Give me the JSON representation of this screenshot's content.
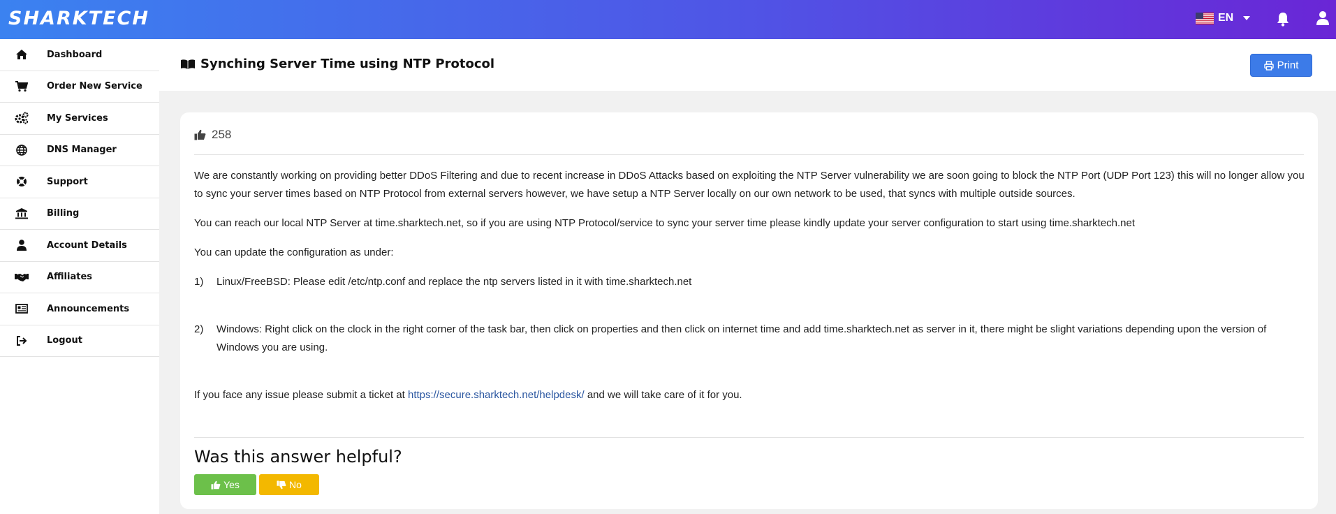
{
  "brand": {
    "logo_text": "SHARKTECH"
  },
  "topbar": {
    "language": "EN",
    "icons": [
      "us-flag-icon",
      "caret-down-icon",
      "bell-icon",
      "user-icon"
    ]
  },
  "sidebar": {
    "items": [
      {
        "label": "Dashboard",
        "icon": "home-icon"
      },
      {
        "label": "Order New Service",
        "icon": "cart-icon"
      },
      {
        "label": "My Services",
        "icon": "cogs-icon"
      },
      {
        "label": "DNS Manager",
        "icon": "globe-icon"
      },
      {
        "label": "Support",
        "icon": "life-ring-icon"
      },
      {
        "label": "Billing",
        "icon": "bank-icon"
      },
      {
        "label": "Account Details",
        "icon": "user-icon"
      },
      {
        "label": "Affiliates",
        "icon": "handshake-icon"
      },
      {
        "label": "Announcements",
        "icon": "newspaper-icon"
      },
      {
        "label": "Logout",
        "icon": "sign-out-icon"
      }
    ]
  },
  "header": {
    "title": "Synching Server Time using NTP Protocol",
    "print_label": "Print"
  },
  "article": {
    "likes": "258",
    "p1": "We are constantly working on providing better DDoS Filtering and due to recent increase in DDoS Attacks based on exploiting the NTP Server vulnerability we are soon going to block the NTP Port (UDP Port 123) this will no longer allow you to sync your server times based on NTP Protocol from external servers however, we have setup a NTP Server locally on our own network to be used, that syncs with multiple outside sources.",
    "p2": "You can reach our local NTP Server at time.sharktech.net, so if you are using NTP Protocol/service to sync your server time please kindly update your server configuration to start using time.sharktech.net",
    "p3": "You can update the configuration as under:",
    "step1_num": "1)",
    "step1": "Linux/FreeBSD: Please edit /etc/ntp.conf and replace the ntp servers listed in it with time.sharktech.net",
    "step2_num": "2)",
    "step2": "Windows: Right click on the clock in the right corner of the task bar, then click on properties and then click on internet time and add time.sharktech.net as server in it, there might be slight variations depending upon the version of Windows you are using.",
    "p_last_prefix": "If you face any issue please submit a ticket at ",
    "p_last_link": "https://secure.sharktech.net/helpdesk/",
    "p_last_suffix": " and we will take care of it for you."
  },
  "feedback": {
    "title": "Was this answer helpful?",
    "yes_label": "Yes",
    "no_label": "No"
  },
  "colors": {
    "gradient_start": "#3b82f0",
    "gradient_end": "#6a26d6",
    "print_button": "#3c7be8",
    "yes_button": "#6cc04a",
    "no_button": "#f3b800",
    "link": "#2a56a0"
  }
}
